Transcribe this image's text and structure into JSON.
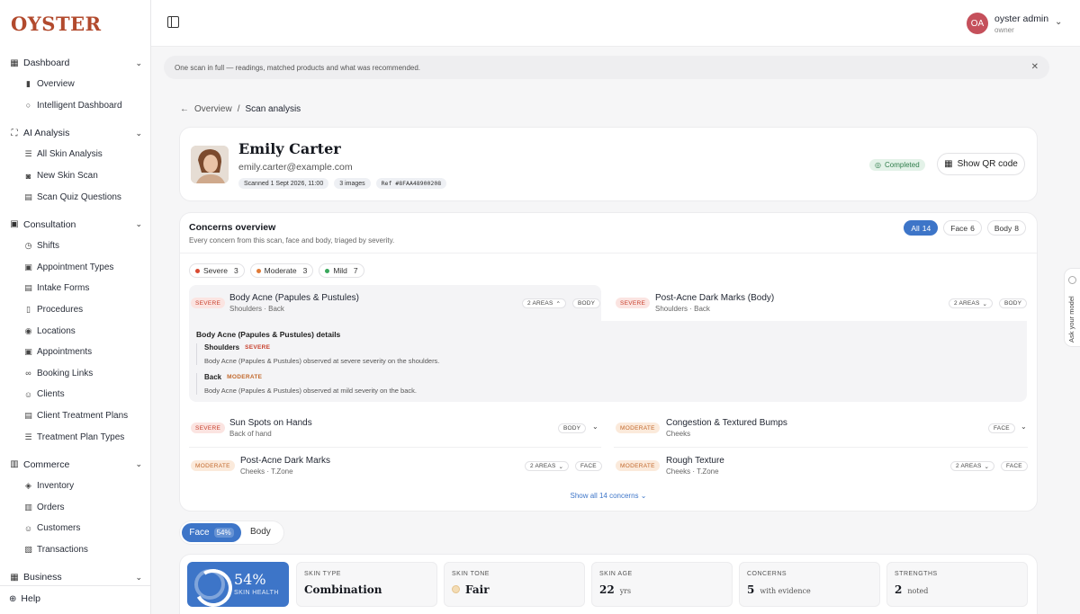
{
  "brand": "OYSTER",
  "sidebar": {
    "groups": [
      {
        "label": "Dashboard",
        "icon": "grid-icon",
        "items": [
          {
            "label": "Overview",
            "icon": "bar-chart-icon"
          },
          {
            "label": "Intelligent Dashboard",
            "icon": "circle-icon"
          }
        ]
      },
      {
        "label": "AI Analysis",
        "icon": "scan-icon",
        "items": [
          {
            "label": "All Skin Analysis",
            "icon": "list-icon"
          },
          {
            "label": "New Skin Scan",
            "icon": "camera-icon"
          },
          {
            "label": "Scan Quiz Questions",
            "icon": "clipboard-icon"
          }
        ]
      },
      {
        "label": "Consultation",
        "icon": "calendar-icon",
        "items": [
          {
            "label": "Shifts",
            "icon": "clock-icon"
          },
          {
            "label": "Appointment Types",
            "icon": "calendar-icon"
          },
          {
            "label": "Intake Forms",
            "icon": "form-icon"
          },
          {
            "label": "Procedures",
            "icon": "document-icon"
          },
          {
            "label": "Locations",
            "icon": "pin-icon"
          },
          {
            "label": "Appointments",
            "icon": "calendar-check-icon"
          },
          {
            "label": "Booking Links",
            "icon": "link-icon"
          },
          {
            "label": "Clients",
            "icon": "users-icon"
          },
          {
            "label": "Client Treatment Plans",
            "icon": "clipboard-icon"
          },
          {
            "label": "Treatment Plan Types",
            "icon": "list-icon"
          }
        ]
      },
      {
        "label": "Commerce",
        "icon": "cart-icon",
        "items": [
          {
            "label": "Inventory",
            "icon": "box-icon"
          },
          {
            "label": "Orders",
            "icon": "cart-icon"
          },
          {
            "label": "Customers",
            "icon": "user-icon"
          },
          {
            "label": "Transactions",
            "icon": "receipt-icon"
          }
        ]
      },
      {
        "label": "Business",
        "icon": "building-icon",
        "items": []
      }
    ],
    "help": "Help"
  },
  "user": {
    "initials": "OA",
    "name": "oyster admin",
    "role": "owner"
  },
  "banner": "One scan in full — readings, matched products and what was recommended.",
  "breadcrumb": {
    "back": "Overview",
    "separator": "/",
    "current": "Scan analysis"
  },
  "profile": {
    "name": "Emily Carter",
    "email": "emily.carter@example.com",
    "scanned": "Scanned 1 Sept 2026, 11:00",
    "images": "3 images",
    "ref": "Ref #8FAA48900208",
    "status": "Completed",
    "qr_label": "Show QR code"
  },
  "concerns": {
    "title": "Concerns overview",
    "subtitle": "Every concern from this scan, face and body, triaged by severity.",
    "filters": [
      {
        "label": "All",
        "count": "14"
      },
      {
        "label": "Face",
        "count": "6"
      },
      {
        "label": "Body",
        "count": "8"
      }
    ],
    "severity_counts": [
      {
        "label": "Severe",
        "count": "3",
        "color": "#d94a32"
      },
      {
        "label": "Moderate",
        "count": "3",
        "color": "#e07a36"
      },
      {
        "label": "Mild",
        "count": "7",
        "color": "#3aa85c"
      }
    ],
    "rows": [
      {
        "severity": "SEVERE",
        "title": "Body Acne (Papules & Pustules)",
        "sub": "Shoulders · Back",
        "areas": "2 AREAS",
        "region": "BODY"
      },
      {
        "severity": "SEVERE",
        "title": "Post-Acne Dark Marks (Body)",
        "sub": "Shoulders · Back",
        "areas": "2 AREAS",
        "region": "BODY"
      },
      {
        "severity": "SEVERE",
        "title": "Sun Spots on Hands",
        "sub": "Back of hand",
        "areas": "",
        "region": "BODY"
      },
      {
        "severity": "MODERATE",
        "title": "Congestion & Textured Bumps",
        "sub": "Cheeks",
        "areas": "",
        "region": "FACE"
      },
      {
        "severity": "MODERATE",
        "title": "Post-Acne Dark Marks",
        "sub": "Cheeks · T.Zone",
        "areas": "2 AREAS",
        "region": "FACE"
      },
      {
        "severity": "MODERATE",
        "title": "Rough Texture",
        "sub": "Cheeks · T.Zone",
        "areas": "2 AREAS",
        "region": "FACE"
      }
    ],
    "details": {
      "title": "Body Acne (Papules & Pustules) details",
      "entries": [
        {
          "area": "Shoulders",
          "severity": "SEVERE",
          "text": "Body Acne (Papules & Pustules) observed at severe severity on the shoulders."
        },
        {
          "area": "Back",
          "severity": "MODERATE",
          "text": "Body Acne (Papules & Pustules) observed at mild severity on the back."
        }
      ]
    },
    "show_all": "Show all 14 concerns"
  },
  "segment": {
    "active": "Face",
    "active_pct": "54%",
    "inactive": "Body"
  },
  "stats": {
    "health_pct": "54%",
    "health_label": "SKIN HEALTH",
    "skin_type": {
      "label": "SKIN TYPE",
      "value": "Combination"
    },
    "skin_tone": {
      "label": "SKIN TONE",
      "value": "Fair"
    },
    "skin_age": {
      "label": "SKIN AGE",
      "value": "22",
      "unit": "yrs"
    },
    "concerns": {
      "label": "CONCERNS",
      "value": "5",
      "unit": "with evidence"
    },
    "strengths": {
      "label": "STRENGTHS",
      "value": "2",
      "unit": "noted"
    }
  },
  "ask_model": "Ask your model"
}
